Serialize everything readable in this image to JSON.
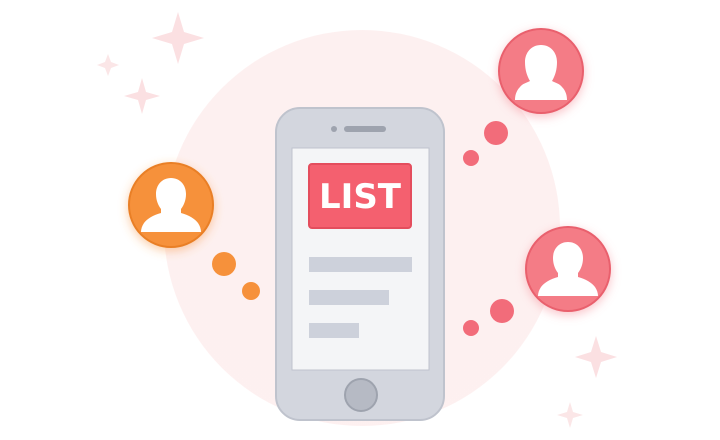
{
  "list_badge": {
    "label": "LIST"
  },
  "colors": {
    "background_blob": "#fdeeee",
    "sparkle": "#fbe0e2",
    "phone_body": "#d3d6de",
    "phone_stroke": "#bfc3cd",
    "phone_screen": "#f4f5f7",
    "content_bar": "#cdd1db",
    "badge_red": "#f4606f",
    "avatar_orange": "#f6913b",
    "avatar_pink": "#f47c86",
    "dot_orange": "#f6913b",
    "dot_pink": "#f26c7a"
  },
  "avatars": [
    {
      "name": "female-user-icon",
      "color_key": "avatar_pink"
    },
    {
      "name": "male-user-icon",
      "color_key": "avatar_orange"
    },
    {
      "name": "male-user-icon",
      "color_key": "avatar_pink"
    }
  ],
  "icons": [
    "female-user-icon",
    "male-user-icon",
    "sparkle-icon",
    "home-button-icon"
  ]
}
